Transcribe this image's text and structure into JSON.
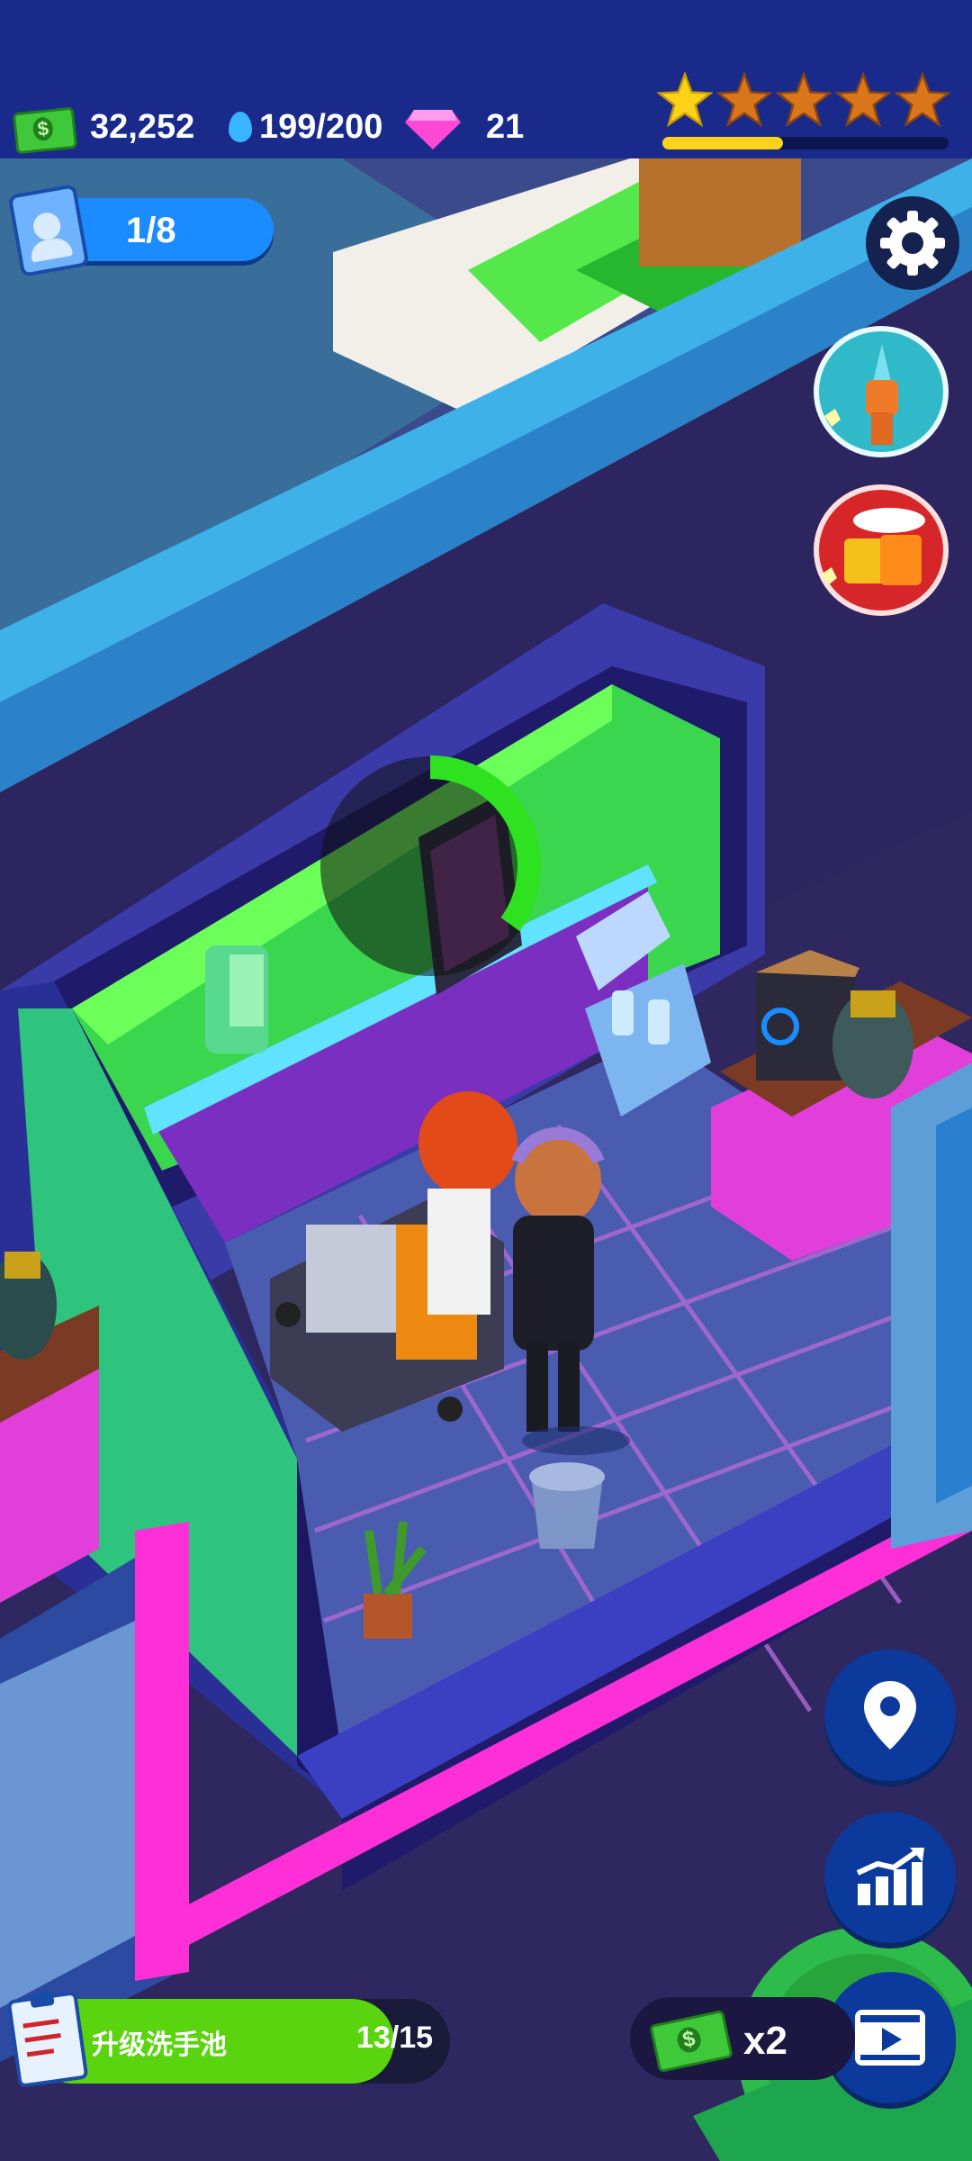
{
  "hud": {
    "cash": "32,252",
    "water": "199/200",
    "gems": "21",
    "stars_filled": 1,
    "stars_total": 5,
    "star_progress": 0.42
  },
  "staff": {
    "label": "1/8"
  },
  "task": {
    "label": "升级洗手池",
    "count": "13/15",
    "progress": 0.8667
  },
  "boost": {
    "label": "x2"
  },
  "task_progress_ring": 0.35,
  "icons": [
    "cash-icon",
    "water-drop-icon",
    "gem-icon",
    "star-icon",
    "id-card-icon",
    "settings-gear-icon",
    "pump-it-icon",
    "gift-bags-icon",
    "location-pin-icon",
    "growth-chart-icon",
    "video-ad-icon",
    "clipboard-icon",
    "cash-bill-icon"
  ],
  "colors": {
    "topbar": "#1a2a8a",
    "accent_blue": "#1a8cff",
    "accent_green": "#57d60f",
    "star_gold": "#ffd21a",
    "star_bronze": "#d9761c"
  }
}
